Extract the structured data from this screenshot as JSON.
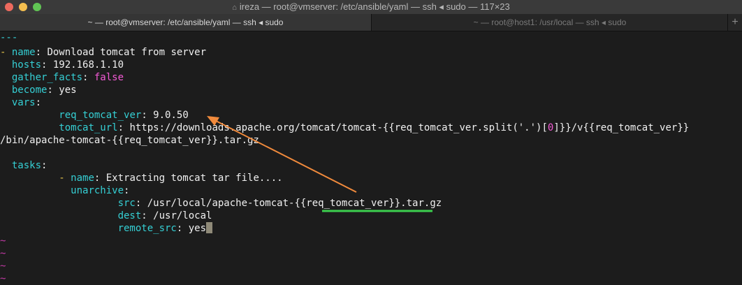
{
  "window": {
    "title": "ireza — root@vmserver: /etc/ansible/yaml — ssh ◂ sudo — 117×23"
  },
  "tabs": [
    {
      "label": "~ — root@vmserver: /etc/ansible/yaml — ssh ◂ sudo",
      "active": true
    },
    {
      "label": "~ — root@host1: /usr/local — ssh ◂ sudo",
      "active": false
    }
  ],
  "tab_add_label": "+",
  "editor": {
    "doc_start": "---",
    "play_dash": "- ",
    "k_name": "name",
    "play_name": "Download tomcat from server",
    "k_hosts": "hosts",
    "hosts": "192.168.1.10",
    "k_gather": "gather_facts",
    "gather_facts": "false",
    "k_become": "become",
    "become": "yes",
    "k_vars": "vars",
    "k_req_ver": "req_tomcat_ver",
    "req_ver": "9.0.50",
    "k_tomcat_url": "tomcat_url",
    "url_part1": "https://downloads.apache.org/tomcat/tomcat-{{req_tomcat_ver.split('.')[",
    "url_index": "0",
    "url_part2": "]}}/v{{req_tomcat_ver}}",
    "url_cont": "/bin/apache-tomcat-{{req_tomcat_ver}}.tar.gz",
    "k_tasks": "tasks",
    "task_dash": "- ",
    "task_name": "Extracting tomcat tar file....",
    "k_unarchive": "unarchive",
    "k_src": "src",
    "src_prefix": "/usr/local/apache-tomcat-",
    "src_var": "{{req_tomcat_ver}}",
    "src_suffix": ".tar.gz",
    "k_dest": "dest",
    "dest": "/usr/local",
    "k_remote_src": "remote_src",
    "remote_src": "yes",
    "empty_line_marker": "~"
  },
  "colors": {
    "key": "#35cfd4",
    "value": "#f0f0f0",
    "boolean": "#f35ad5",
    "dash": "#e5c44b",
    "tilde": "#c23aa5",
    "arrow": "#f08a3c",
    "underline": "#3ccf4e"
  }
}
